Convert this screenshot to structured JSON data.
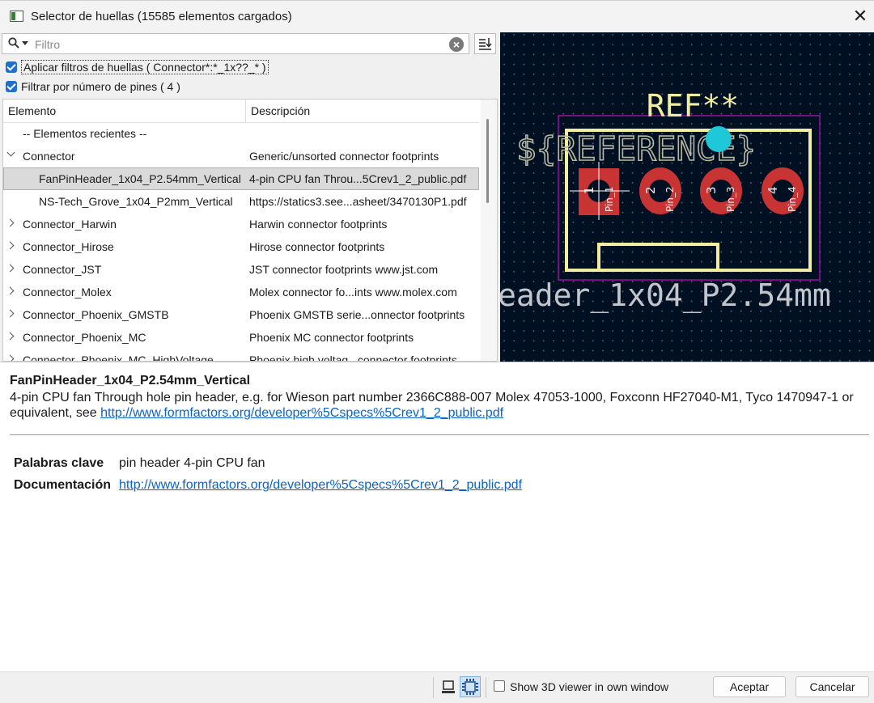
{
  "window": {
    "title": "Selector de huellas (15585 elementos cargados)"
  },
  "filter": {
    "placeholder": "Filtro",
    "value": ""
  },
  "checkboxes": {
    "apply_filters": "Aplicar filtros de huellas ( Connector*:*_1x??_* )",
    "pin_count": "Filtrar por número de pines ( 4 )"
  },
  "tree": {
    "columns": [
      "Elemento",
      "Descripción"
    ],
    "rows": [
      {
        "name": "-- Elementos recientes --",
        "desc": ""
      },
      {
        "name": "Connector",
        "desc": "Generic/unsorted connector footprints"
      },
      {
        "name": "FanPinHeader_1x04_P2.54mm_Vertical",
        "desc": "4-pin CPU fan Throu...5Crev1_2_public.pdf"
      },
      {
        "name": "NS-Tech_Grove_1x04_P2mm_Vertical",
        "desc": "https://statics3.see...asheet/3470130P1.pdf"
      },
      {
        "name": "Connector_Harwin",
        "desc": "Harwin connector footprints"
      },
      {
        "name": "Connector_Hirose",
        "desc": "Hirose connector footprints"
      },
      {
        "name": "Connector_JST",
        "desc": "JST connector footprints www.jst.com"
      },
      {
        "name": "Connector_Molex",
        "desc": "Molex connector fo...ints www.molex.com"
      },
      {
        "name": "Connector_Phoenix_GMSTB",
        "desc": "Phoenix GMSTB serie...onnector footprints"
      },
      {
        "name": "Connector_Phoenix_MC",
        "desc": "Phoenix MC connector footprints"
      },
      {
        "name": "Connector_Phoenix_MC_HighVoltage",
        "desc": "Phoenix high voltag...connector footprints"
      }
    ]
  },
  "preview": {
    "ref_text": "REF**",
    "reference_text": "${REFERENCE}",
    "value_text": "eader_1x04_P2.54mm",
    "pads": [
      {
        "num": "1",
        "label": "Pin_1"
      },
      {
        "num": "2",
        "label": "Pin_2"
      },
      {
        "num": "3",
        "label": "Pin_3"
      },
      {
        "num": "4",
        "label": "Pin_4"
      }
    ],
    "colors": {
      "background": "#001023",
      "silkscreen": "#f2eda1",
      "pad": "#c83434",
      "courtyard": "#c20fc2",
      "anchor": "#1ec8d8",
      "grid_dot": "#5a6b80"
    }
  },
  "details": {
    "name": "FanPinHeader_1x04_P2.54mm_Vertical",
    "description": "4-pin CPU fan Through hole pin header, e.g. for Wieson part number 2366C888-007 Molex 47053-1000, Foxconn HF27040-M1, Tyco 1470947-1 or equivalent, see",
    "description_link": "http://www.formfactors.org/developer%5Cspecs%5Crev1_2_public.pdf",
    "keywords_label": "Palabras clave",
    "keywords": "pin header 4-pin CPU fan",
    "doc_label": "Documentación",
    "doc_link": "http://www.formfactors.org/developer%5Cspecs%5Crev1_2_public.pdf",
    "link_color": "#0b63c4"
  },
  "footer": {
    "show3d_label": "Show 3D viewer in own window",
    "accept": "Aceptar",
    "cancel": "Cancelar"
  }
}
